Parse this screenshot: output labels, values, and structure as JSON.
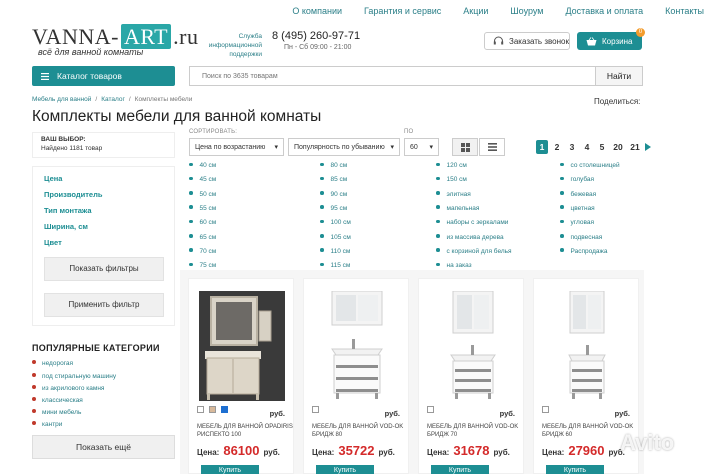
{
  "topnav": [
    "О компании",
    "Гарантия и сервис",
    "Акции",
    "Шоурум",
    "Доставка и оплата",
    "Контакты"
  ],
  "logo": {
    "left": "VANNA-",
    "accent": "ART",
    "right": ".ru",
    "tagline": "всё для ванной комнаты"
  },
  "service": {
    "label": "Служба информационной поддержки",
    "phone": "8 (495) 260-97-71",
    "hours": "Пн - Сб 09:00 - 21:00"
  },
  "header": {
    "call_label": "Заказать звонок",
    "cart_label": "Корзина",
    "cart_count": "0"
  },
  "catalog_button": "Каталог товаров",
  "search": {
    "placeholder": "Поиск по 3635 товарам",
    "button": "Найти"
  },
  "breadcrumb": [
    "Мебель для ванной",
    "Каталог",
    "Комплекты мебели"
  ],
  "share_label": "Поделиться:",
  "page_title": "Комплекты мебели для ванной комнаты",
  "choice": {
    "label": "ВАШ ВЫБОР:",
    "found": "Найдено 1181 товар"
  },
  "facets": [
    "Цена",
    "Производитель",
    "Тип монтажа",
    "Ширина, см",
    "Цвет"
  ],
  "filter_buttons": {
    "show": "Показать фильтры",
    "apply": "Применить фильтр"
  },
  "popular": {
    "title": "ПОПУЛЯРНЫЕ КАТЕГОРИИ",
    "items": [
      "недорогая",
      "под стиральную машину",
      "из акрилового камня",
      "классическая",
      "мини мебель",
      "кантри"
    ],
    "more": "Показать ещё"
  },
  "sort": {
    "label": "СОРТИРОВАТЬ:",
    "by_price": "Цена по возрастанию",
    "by_popularity": "Популярность по убыванию",
    "per_page_label": "ПО",
    "per_page": "60"
  },
  "pagination": [
    "1",
    "2",
    "3",
    "4",
    "5",
    "20",
    "21"
  ],
  "filter_columns": [
    [
      "40 см",
      "45 см",
      "50 см",
      "55 см",
      "60 см",
      "65 см",
      "70 см",
      "75 см"
    ],
    [
      "80 см",
      "85 см",
      "90 см",
      "95 см",
      "100 см",
      "105 см",
      "110 см",
      "115 см"
    ],
    [
      "120 см",
      "150 см",
      "элитная",
      "мапельная",
      "наборы с зеркалами",
      "из массива дерева",
      "с корзиной для белья",
      "на заказ"
    ],
    [
      "со столешницей",
      "голубая",
      "бежевая",
      "цветная",
      "угловая",
      "подвесная",
      "Распродажа"
    ]
  ],
  "products": [
    {
      "name": "МЕБЕЛЬ ДЛЯ ВАННОЙ OPADIRIS РИСПЕКТО 100",
      "price": "86100",
      "currency": "руб.",
      "buy": "Купить"
    },
    {
      "name": "МЕБЕЛЬ ДЛЯ ВАННОЙ VOD-OK БРИДЖ 80",
      "price": "35722",
      "currency": "руб.",
      "buy": "Купить"
    },
    {
      "name": "МЕБЕЛЬ ДЛЯ ВАННОЙ VOD-OK БРИДЖ 70",
      "price": "31678",
      "currency": "руб.",
      "buy": "Купить"
    },
    {
      "name": "МЕБЕЛЬ ДЛЯ ВАННОЙ VOD-OK БРИДЖ 60",
      "price": "27960",
      "currency": "руб.",
      "buy": "Купить"
    }
  ],
  "price_prefix": "Цена:",
  "watermark": "Avito",
  "colors": {
    "accent": "#1d8e93",
    "price": "#d42a2a",
    "badge": "#f39c2c"
  }
}
